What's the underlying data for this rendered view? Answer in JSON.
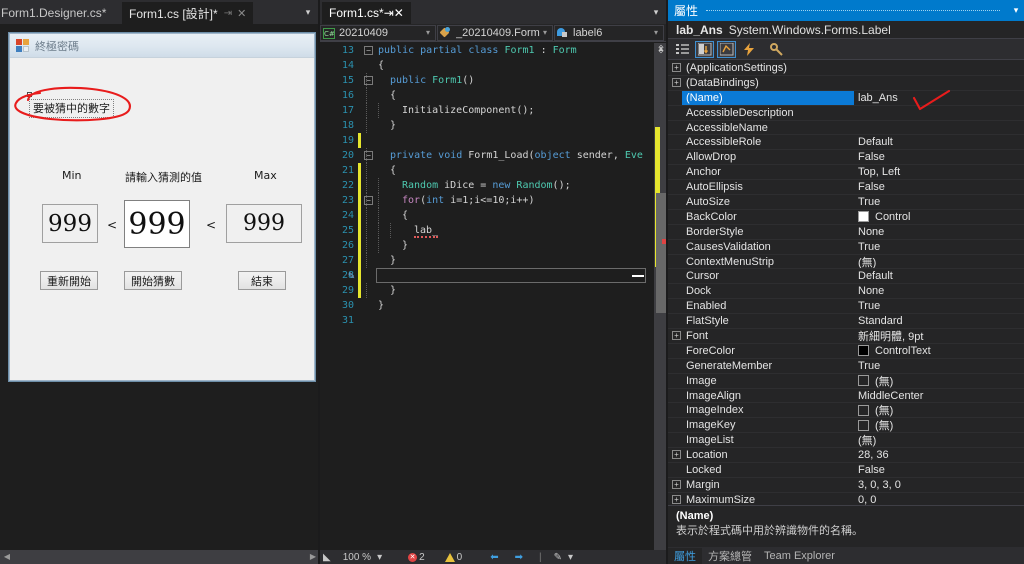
{
  "designer": {
    "tabs": [
      {
        "label": "Form1.Designer.cs*",
        "active": false,
        "pin": "",
        "close": ""
      },
      {
        "label": "Form1.cs [設計]*",
        "active": true,
        "pin": "⇥",
        "close": "✕"
      }
    ],
    "tab_dropdown_icon": "▾",
    "form": {
      "icon_name": "winforms-icon",
      "title": "終極密碼",
      "selected_label": "要被猜中的數字",
      "labels": {
        "min": "Min",
        "guess": "請輸入猜測的值",
        "max": "Max"
      },
      "values": {
        "min": "999",
        "guess": "999",
        "max": "999"
      },
      "operators": {
        "left": "<",
        "right": "<"
      },
      "buttons": {
        "restart": "重新開始",
        "start": "開始猜數",
        "end": "結束"
      }
    },
    "hscroll": {
      "left_arrow": "◀",
      "right_arrow": "▶"
    }
  },
  "editor": {
    "tab": {
      "label": "Form1.cs*",
      "pin": "⇥",
      "close": "✕"
    },
    "tab_dropdown_icon": "▾",
    "navbar": {
      "project": "20210409",
      "class": "_20210409.Form1",
      "member": "label6",
      "caret": "▾"
    },
    "lines": [
      {
        "n": "13",
        "fold": "−",
        "indent": 0,
        "changed": false,
        "tokens": [
          {
            "t": "public ",
            "c": "kw"
          },
          {
            "t": "partial ",
            "c": "kw"
          },
          {
            "t": "class ",
            "c": "kw"
          },
          {
            "t": "Form1 ",
            "c": "type"
          },
          {
            "t": ": ",
            "c": "pl"
          },
          {
            "t": "Form",
            "c": "type"
          }
        ]
      },
      {
        "n": "14",
        "fold": "",
        "indent": 0,
        "changed": false,
        "tokens": [
          {
            "t": "{",
            "c": "pl"
          }
        ]
      },
      {
        "n": "15",
        "fold": "−",
        "indent": 1,
        "changed": false,
        "tokens": [
          {
            "t": "public ",
            "c": "kw"
          },
          {
            "t": "Form1",
            "c": "type"
          },
          {
            "t": "()",
            "c": "pl"
          }
        ]
      },
      {
        "n": "16",
        "fold": "",
        "indent": 1,
        "changed": false,
        "tokens": [
          {
            "t": "{",
            "c": "pl"
          }
        ]
      },
      {
        "n": "17",
        "fold": "",
        "indent": 2,
        "changed": false,
        "tokens": [
          {
            "t": "InitializeComponent",
            "c": "pl"
          },
          {
            "t": "();",
            "c": "pl"
          }
        ]
      },
      {
        "n": "18",
        "fold": "",
        "indent": 1,
        "changed": false,
        "tokens": [
          {
            "t": "}",
            "c": "pl"
          }
        ]
      },
      {
        "n": "19",
        "fold": "",
        "indent": 0,
        "changed": true,
        "tokens": []
      },
      {
        "n": "20",
        "fold": "−",
        "indent": 1,
        "changed": false,
        "tokens": [
          {
            "t": "private ",
            "c": "kw"
          },
          {
            "t": "void ",
            "c": "kw"
          },
          {
            "t": "Form1_Load",
            "c": "pl"
          },
          {
            "t": "(",
            "c": "pl"
          },
          {
            "t": "object ",
            "c": "kw"
          },
          {
            "t": "sender",
            "c": "pl"
          },
          {
            "t": ", ",
            "c": "pl"
          },
          {
            "t": "Eve",
            "c": "type"
          }
        ]
      },
      {
        "n": "21",
        "fold": "",
        "indent": 1,
        "changed": true,
        "tokens": [
          {
            "t": "{",
            "c": "pl"
          }
        ]
      },
      {
        "n": "22",
        "fold": "",
        "indent": 2,
        "changed": true,
        "tokens": [
          {
            "t": "Random ",
            "c": "type"
          },
          {
            "t": "iDice = ",
            "c": "pl"
          },
          {
            "t": "new ",
            "c": "kw"
          },
          {
            "t": "Random",
            "c": "type"
          },
          {
            "t": "();",
            "c": "pl"
          }
        ]
      },
      {
        "n": "23",
        "fold": "−",
        "indent": 2,
        "changed": true,
        "tokens": [
          {
            "t": "for",
            "c": "kw2"
          },
          {
            "t": "(",
            "c": "pl"
          },
          {
            "t": "int ",
            "c": "kw"
          },
          {
            "t": "i=1;i<=10;i++)",
            "c": "pl"
          }
        ]
      },
      {
        "n": "24",
        "fold": "",
        "indent": 2,
        "changed": true,
        "tokens": [
          {
            "t": "{",
            "c": "pl"
          }
        ]
      },
      {
        "n": "25",
        "fold": "",
        "indent": 3,
        "changed": true,
        "tokens": [
          {
            "t": "lab_",
            "c": "squig"
          }
        ]
      },
      {
        "n": "26",
        "fold": "",
        "indent": 2,
        "changed": true,
        "tokens": [
          {
            "t": "}",
            "c": "pl"
          }
        ]
      },
      {
        "n": "27",
        "fold": "",
        "indent": 1,
        "changed": true,
        "tokens": [
          {
            "t": "}",
            "c": "pl"
          }
        ]
      },
      {
        "n": "28",
        "fold": "",
        "indent": 0,
        "changed": true,
        "tokens": []
      },
      {
        "n": "29",
        "fold": "",
        "indent": 1,
        "changed": true,
        "tokens": [
          {
            "t": "}",
            "c": "pl"
          }
        ]
      },
      {
        "n": "30",
        "fold": "",
        "indent": 0,
        "changed": false,
        "tokens": [
          {
            "t": "}",
            "c": "pl"
          }
        ]
      },
      {
        "n": "31",
        "fold": "",
        "indent": 0,
        "changed": false,
        "tokens": []
      }
    ],
    "statusbar": {
      "left_arrow": "◣",
      "zoom": "100 %",
      "zoom_caret": "▾",
      "error_count": "2",
      "warning_count": "0",
      "back_icon": "back-arrow-icon",
      "forward_icon": "forward-arrow-icon",
      "pen_icon": "pen-icon",
      "pen_caret": "▾"
    }
  },
  "properties": {
    "title": "屬性",
    "title_caret": "▾",
    "object_name": "lab_Ans",
    "object_type": "System.Windows.Forms.Label",
    "toolbar": [
      {
        "name": "categorized-view-button",
        "glyph": "categorized-icon",
        "selected": false
      },
      {
        "name": "alphabetical-view-button",
        "glyph": "alphabetical-icon",
        "selected": true
      },
      {
        "name": "properties-view-button",
        "glyph": "properties-icon",
        "selected": true
      },
      {
        "name": "events-view-button",
        "glyph": "events-icon",
        "selected": false
      },
      {
        "name": "property-pages-button",
        "glyph": "wrench-icon",
        "selected": false
      }
    ],
    "rows": [
      {
        "expander": "+",
        "name": "(ApplicationSettings)",
        "value": "",
        "selected": false,
        "swatch": ""
      },
      {
        "expander": "+",
        "name": "(DataBindings)",
        "value": "",
        "selected": false,
        "swatch": ""
      },
      {
        "expander": "",
        "name": "(Name)",
        "value": "lab_Ans",
        "selected": true,
        "swatch": ""
      },
      {
        "expander": "",
        "name": "AccessibleDescription",
        "value": "",
        "selected": false,
        "swatch": ""
      },
      {
        "expander": "",
        "name": "AccessibleName",
        "value": "",
        "selected": false,
        "swatch": ""
      },
      {
        "expander": "",
        "name": "AccessibleRole",
        "value": "Default",
        "selected": false,
        "swatch": ""
      },
      {
        "expander": "",
        "name": "AllowDrop",
        "value": "False",
        "selected": false,
        "swatch": ""
      },
      {
        "expander": "",
        "name": "Anchor",
        "value": "Top, Left",
        "selected": false,
        "swatch": ""
      },
      {
        "expander": "",
        "name": "AutoEllipsis",
        "value": "False",
        "selected": false,
        "swatch": ""
      },
      {
        "expander": "",
        "name": "AutoSize",
        "value": "True",
        "selected": false,
        "swatch": ""
      },
      {
        "expander": "",
        "name": "BackColor",
        "value": "Control",
        "selected": false,
        "swatch": "#ffffff"
      },
      {
        "expander": "",
        "name": "BorderStyle",
        "value": "None",
        "selected": false,
        "swatch": ""
      },
      {
        "expander": "",
        "name": "CausesValidation",
        "value": "True",
        "selected": false,
        "swatch": ""
      },
      {
        "expander": "",
        "name": "ContextMenuStrip",
        "value": "(無)",
        "selected": false,
        "swatch": ""
      },
      {
        "expander": "",
        "name": "Cursor",
        "value": "Default",
        "selected": false,
        "swatch": ""
      },
      {
        "expander": "",
        "name": "Dock",
        "value": "None",
        "selected": false,
        "swatch": ""
      },
      {
        "expander": "",
        "name": "Enabled",
        "value": "True",
        "selected": false,
        "swatch": ""
      },
      {
        "expander": "",
        "name": "FlatStyle",
        "value": "Standard",
        "selected": false,
        "swatch": ""
      },
      {
        "expander": "+",
        "name": "Font",
        "value": "新細明體, 9pt",
        "selected": false,
        "swatch": ""
      },
      {
        "expander": "",
        "name": "ForeColor",
        "value": "ControlText",
        "selected": false,
        "swatch": "#000000"
      },
      {
        "expander": "",
        "name": "GenerateMember",
        "value": "True",
        "selected": false,
        "swatch": ""
      },
      {
        "expander": "",
        "name": "Image",
        "value": "(無)",
        "selected": false,
        "swatch": "transparent"
      },
      {
        "expander": "",
        "name": "ImageAlign",
        "value": "MiddleCenter",
        "selected": false,
        "swatch": ""
      },
      {
        "expander": "",
        "name": "ImageIndex",
        "value": "(無)",
        "selected": false,
        "swatch": "transparent"
      },
      {
        "expander": "",
        "name": "ImageKey",
        "value": "(無)",
        "selected": false,
        "swatch": "transparent"
      },
      {
        "expander": "",
        "name": "ImageList",
        "value": "(無)",
        "selected": false,
        "swatch": ""
      },
      {
        "expander": "+",
        "name": "Location",
        "value": "28, 36",
        "selected": false,
        "swatch": ""
      },
      {
        "expander": "",
        "name": "Locked",
        "value": "False",
        "selected": false,
        "swatch": ""
      },
      {
        "expander": "+",
        "name": "Margin",
        "value": "3, 0, 3, 0",
        "selected": false,
        "swatch": ""
      },
      {
        "expander": "+",
        "name": "MaximumSize",
        "value": "0, 0",
        "selected": false,
        "swatch": ""
      }
    ],
    "description": {
      "title": "(Name)",
      "body": "表示於程式碼中用於辨識物件的名稱。"
    },
    "bottom_tabs": [
      {
        "label": "屬性",
        "active": true
      },
      {
        "label": "方案總管",
        "active": false
      },
      {
        "label": "Team Explorer",
        "active": false
      }
    ]
  },
  "annotations": {
    "circle_color": "#e81c1c",
    "check_color": "#e81c1c"
  }
}
